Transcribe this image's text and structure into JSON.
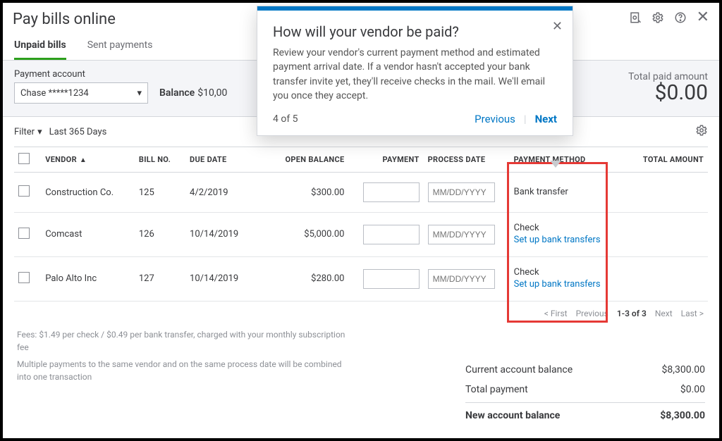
{
  "window": {
    "title": "Pay bills online"
  },
  "tabs": {
    "unpaid": "Unpaid bills",
    "sent": "Sent payments"
  },
  "account": {
    "label": "Payment account",
    "value": "Chase *****1234",
    "balance_label": "Balance",
    "balance_value": "$10,00"
  },
  "total_paid": {
    "label": "Total paid amount",
    "amount": "$0.00"
  },
  "filter": {
    "label": "Filter",
    "range": "Last 365 Days"
  },
  "columns": {
    "vendor": "VENDOR",
    "bill_no": "BILL NO.",
    "due_date": "DUE DATE",
    "open_balance": "OPEN BALANCE",
    "payment": "PAYMENT",
    "process_date": "PROCESS DATE",
    "payment_method": "PAYMENT METHOD",
    "total_amount": "TOTAL AMOUNT"
  },
  "date_placeholder": "MM/DD/YYYY",
  "setup_link": "Set up bank transfers",
  "rows": [
    {
      "vendor": "Construction Co.",
      "bill_no": "125",
      "due_date": "4/2/2019",
      "open_balance": "$300.00",
      "payment_method": "Bank transfer",
      "setup_link": false
    },
    {
      "vendor": "Comcast",
      "bill_no": "126",
      "due_date": "10/14/2019",
      "open_balance": "$5,000.00",
      "payment_method": "Check",
      "setup_link": true
    },
    {
      "vendor": "Palo Alto Inc",
      "bill_no": "127",
      "due_date": "10/14/2019",
      "open_balance": "$280.00",
      "payment_method": "Check",
      "setup_link": true
    }
  ],
  "pager": {
    "first": "< First",
    "prev": "Previous",
    "range": "1-3 of 3",
    "next": "Next",
    "last": "Last >"
  },
  "fees": {
    "line1": "Fees: $1.49 per check / $0.49 per bank transfer, charged with your monthly subscription fee",
    "line2": "Multiple payments to the same vendor and on the same process date will be combined into one transaction"
  },
  "summary": {
    "current_label": "Current account balance",
    "current_value": "$8,300.00",
    "total_label": "Total payment",
    "total_value": "$0.00",
    "new_label": "New account balance",
    "new_value": "$8,300.00"
  },
  "tour": {
    "title": "How will your vendor be paid?",
    "body": "Review your vendor's current payment method and estimated payment arrival date. If a vendor hasn't accepted your bank transfer invite yet, they'll receive checks in the mail. We'll email you once they accept.",
    "step": "4 of 5",
    "prev": "Previous",
    "next": "Next"
  }
}
